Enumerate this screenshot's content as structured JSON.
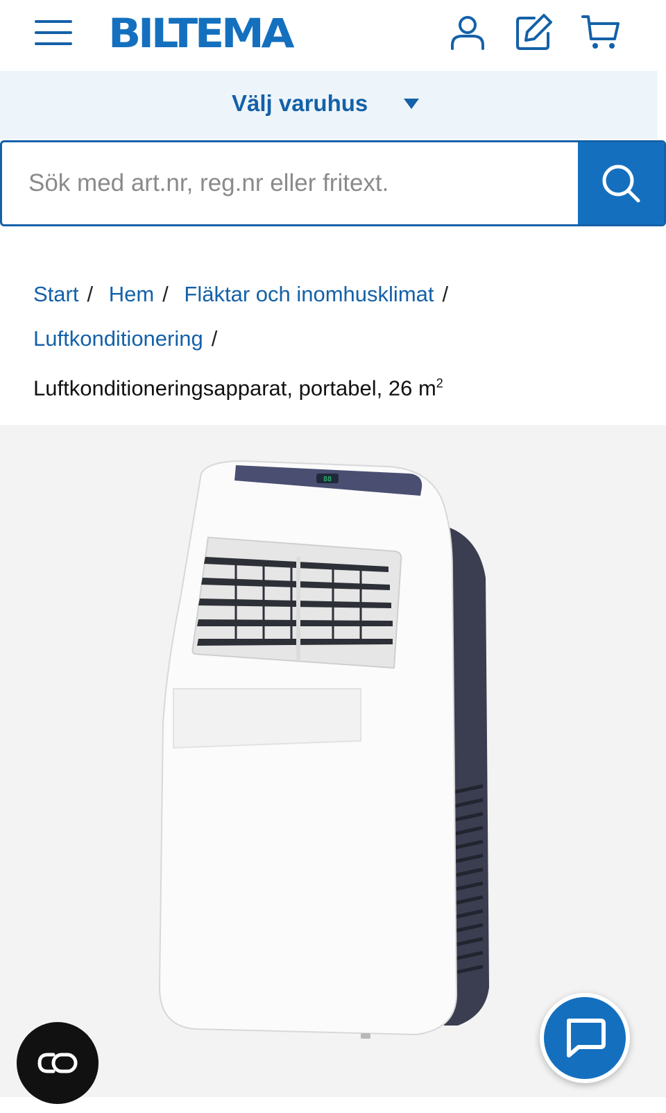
{
  "header": {
    "logo_text": "BILTEMA",
    "icons": [
      "menu-icon",
      "user-icon",
      "edit-icon",
      "cart-icon"
    ],
    "brand_color": "#1470bf"
  },
  "store_selector": {
    "label": "Välj varuhus"
  },
  "search": {
    "placeholder": "Sök med art.nr, reg.nr eller fritext.",
    "value": ""
  },
  "breadcrumb": {
    "items": [
      {
        "label": "Start"
      },
      {
        "label": "Hem"
      },
      {
        "label": "Fläktar och inomhusklimat"
      },
      {
        "label": "Luftkonditionering"
      }
    ],
    "separator": "/",
    "current": "Luftkonditioneringsapparat, portabel, 26 m",
    "current_sup": "2"
  },
  "product": {
    "image": "portable-air-conditioner-image"
  },
  "floating": {
    "cookie_icon": "cookie-settings-icon",
    "chat_icon": "chat-icon"
  }
}
